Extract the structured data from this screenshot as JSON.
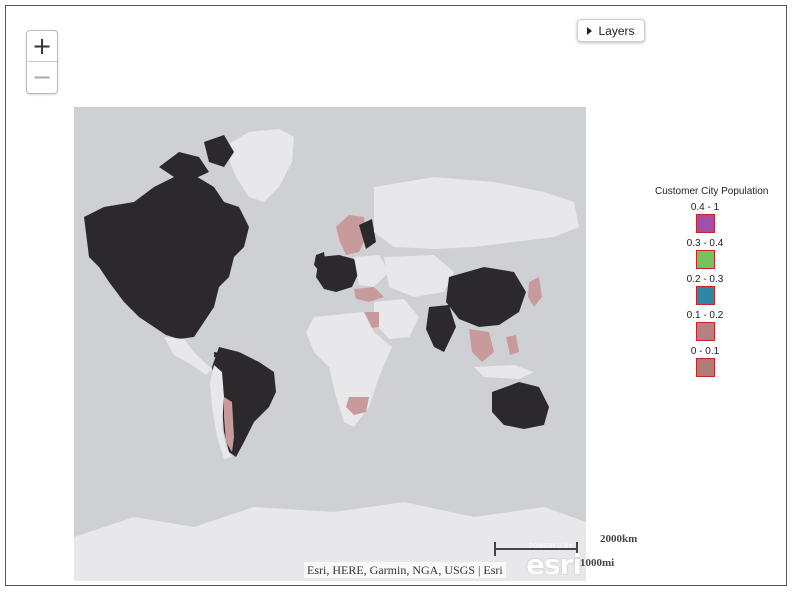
{
  "zoom": {
    "in_label": "+",
    "out_label": "−"
  },
  "layers": {
    "label": "Layers"
  },
  "map": {
    "ocean_color": "#cfd0d4",
    "land_color": "#e8e7ea",
    "dark_color": "#2b292b",
    "pink_color": "#c99a9c",
    "attribution": "Esri, HERE, Garmin, NGA, USGS | Esri",
    "scale_km": "2000km",
    "scale_mi": "1000mi",
    "logo_powered": "POWERED BY",
    "logo_text": "esri"
  },
  "legend": {
    "title": "Customer City Population",
    "items": [
      {
        "label": "0.4 - 1",
        "color": "#a14fa8"
      },
      {
        "label": "0.3 - 0.4",
        "color": "#74c25e"
      },
      {
        "label": "0.2 - 0.3",
        "color": "#2f87a6"
      },
      {
        "label": "0.1 - 0.2",
        "color": "#b58080"
      },
      {
        "label": "0 - 0.1",
        "color": "#b07c78"
      }
    ]
  }
}
